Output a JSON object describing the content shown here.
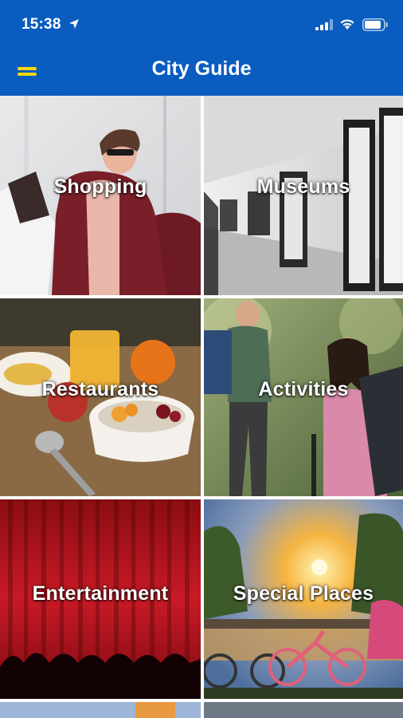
{
  "status_bar": {
    "time": "15:38"
  },
  "header": {
    "title": "City Guide",
    "menu_color": "#f5d90a",
    "background_color": "#0a5cbf"
  },
  "categories": [
    {
      "label": "Shopping"
    },
    {
      "label": "Museums"
    },
    {
      "label": "Restaurants"
    },
    {
      "label": "Activities"
    },
    {
      "label": "Entertainment"
    },
    {
      "label": "Special Places"
    }
  ]
}
